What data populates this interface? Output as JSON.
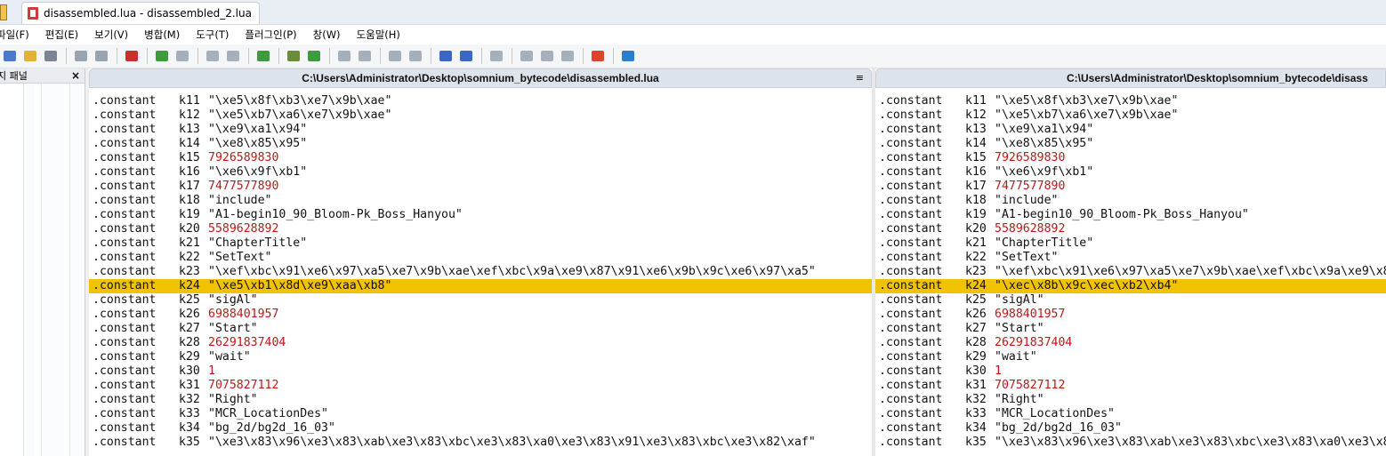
{
  "tab": {
    "title": "disassembled.lua - disassembled_2.lua"
  },
  "menu": [
    "파일(F)",
    "편집(E)",
    "보기(V)",
    "병합(M)",
    "도구(T)",
    "플러그인(P)",
    "창(W)",
    "도움말(H)"
  ],
  "left_panel": {
    "title": "지 패널",
    "close": "×"
  },
  "left_pane": {
    "path": "C:\\Users\\Administrator\\Desktop\\somnium_bytecode\\disassembled.lua",
    "menu_icon": "≡",
    "lines": [
      {
        "dir": ".constant",
        "key": "k11",
        "val": "\"\\xe5\\x8f\\xb3\\xe7\\x9b\\xae\"",
        "num": false
      },
      {
        "dir": ".constant",
        "key": "k12",
        "val": "\"\\xe5\\xb7\\xa6\\xe7\\x9b\\xae\"",
        "num": false
      },
      {
        "dir": ".constant",
        "key": "k13",
        "val": "\"\\xe9\\xa1\\x94\"",
        "num": false
      },
      {
        "dir": ".constant",
        "key": "k14",
        "val": "\"\\xe8\\x85\\x95\"",
        "num": false
      },
      {
        "dir": ".constant",
        "key": "k15",
        "val": "7926589830",
        "num": true
      },
      {
        "dir": ".constant",
        "key": "k16",
        "val": "\"\\xe6\\x9f\\xb1\"",
        "num": false
      },
      {
        "dir": ".constant",
        "key": "k17",
        "val": "7477577890",
        "num": true
      },
      {
        "dir": ".constant",
        "key": "k18",
        "val": "\"include\"",
        "num": false
      },
      {
        "dir": ".constant",
        "key": "k19",
        "val": "\"A1-begin10_90_Bloom-Pk_Boss_Hanyou\"",
        "num": false
      },
      {
        "dir": ".constant",
        "key": "k20",
        "val": "5589628892",
        "num": true
      },
      {
        "dir": ".constant",
        "key": "k21",
        "val": "\"ChapterTitle\"",
        "num": false
      },
      {
        "dir": ".constant",
        "key": "k22",
        "val": "\"SetText\"",
        "num": false
      },
      {
        "dir": ".constant",
        "key": "k23",
        "val": "\"\\xef\\xbc\\x91\\xe6\\x97\\xa5\\xe7\\x9b\\xae\\xef\\xbc\\x9a\\xe9\\x87\\x91\\xe6\\x9b\\x9c\\xe6\\x97\\xa5\"",
        "num": false
      },
      {
        "dir": ".constant",
        "key": "k24",
        "val": "\"\\xe5\\xb1\\x8d\\xe9\\xaa\\xb8\"",
        "num": false,
        "diff": true
      },
      {
        "dir": ".constant",
        "key": "k25",
        "val": "\"sigAl\"",
        "num": false
      },
      {
        "dir": ".constant",
        "key": "k26",
        "val": "6988401957",
        "num": true
      },
      {
        "dir": ".constant",
        "key": "k27",
        "val": "\"Start\"",
        "num": false
      },
      {
        "dir": ".constant",
        "key": "k28",
        "val": "26291837404",
        "num": true
      },
      {
        "dir": ".constant",
        "key": "k29",
        "val": "\"wait\"",
        "num": false
      },
      {
        "dir": ".constant",
        "key": "k30",
        "val": "1",
        "num": true
      },
      {
        "dir": ".constant",
        "key": "k31",
        "val": "7075827112",
        "num": true
      },
      {
        "dir": ".constant",
        "key": "k32",
        "val": "\"Right\"",
        "num": false
      },
      {
        "dir": ".constant",
        "key": "k33",
        "val": "\"MCR_LocationDes\"",
        "num": false
      },
      {
        "dir": ".constant",
        "key": "k34",
        "val": "\"bg_2d/bg2d_16_03\"",
        "num": false
      },
      {
        "dir": ".constant",
        "key": "k35",
        "val": "\"\\xe3\\x83\\x96\\xe3\\x83\\xab\\xe3\\x83\\xbc\\xe3\\x83\\xa0\\xe3\\x83\\x91\\xe3\\x83\\xbc\\xe3\\x82\\xaf\"",
        "num": false
      }
    ]
  },
  "right_pane": {
    "path": "C:\\Users\\Administrator\\Desktop\\somnium_bytecode\\disass",
    "lines": [
      {
        "dir": ".constant",
        "key": "k11",
        "val": "\"\\xe5\\x8f\\xb3\\xe7\\x9b\\xae\"",
        "num": false
      },
      {
        "dir": ".constant",
        "key": "k12",
        "val": "\"\\xe5\\xb7\\xa6\\xe7\\x9b\\xae\"",
        "num": false
      },
      {
        "dir": ".constant",
        "key": "k13",
        "val": "\"\\xe9\\xa1\\x94\"",
        "num": false
      },
      {
        "dir": ".constant",
        "key": "k14",
        "val": "\"\\xe8\\x85\\x95\"",
        "num": false
      },
      {
        "dir": ".constant",
        "key": "k15",
        "val": "7926589830",
        "num": true
      },
      {
        "dir": ".constant",
        "key": "k16",
        "val": "\"\\xe6\\x9f\\xb1\"",
        "num": false
      },
      {
        "dir": ".constant",
        "key": "k17",
        "val": "7477577890",
        "num": true
      },
      {
        "dir": ".constant",
        "key": "k18",
        "val": "\"include\"",
        "num": false
      },
      {
        "dir": ".constant",
        "key": "k19",
        "val": "\"A1-begin10_90_Bloom-Pk_Boss_Hanyou\"",
        "num": false
      },
      {
        "dir": ".constant",
        "key": "k20",
        "val": "5589628892",
        "num": true
      },
      {
        "dir": ".constant",
        "key": "k21",
        "val": "\"ChapterTitle\"",
        "num": false
      },
      {
        "dir": ".constant",
        "key": "k22",
        "val": "\"SetText\"",
        "num": false
      },
      {
        "dir": ".constant",
        "key": "k23",
        "val": "\"\\xef\\xbc\\x91\\xe6\\x97\\xa5\\xe7\\x9b\\xae\\xef\\xbc\\x9a\\xe9\\x8",
        "num": false
      },
      {
        "dir": ".constant",
        "key": "k24",
        "val": "\"\\xec\\x8b\\x9c\\xec\\xb2\\xb4\"",
        "num": false,
        "diff": true
      },
      {
        "dir": ".constant",
        "key": "k25",
        "val": "\"sigAl\"",
        "num": false
      },
      {
        "dir": ".constant",
        "key": "k26",
        "val": "6988401957",
        "num": true
      },
      {
        "dir": ".constant",
        "key": "k27",
        "val": "\"Start\"",
        "num": false
      },
      {
        "dir": ".constant",
        "key": "k28",
        "val": "26291837404",
        "num": true
      },
      {
        "dir": ".constant",
        "key": "k29",
        "val": "\"wait\"",
        "num": false
      },
      {
        "dir": ".constant",
        "key": "k30",
        "val": "1",
        "num": true
      },
      {
        "dir": ".constant",
        "key": "k31",
        "val": "7075827112",
        "num": true
      },
      {
        "dir": ".constant",
        "key": "k32",
        "val": "\"Right\"",
        "num": false
      },
      {
        "dir": ".constant",
        "key": "k33",
        "val": "\"MCR_LocationDes\"",
        "num": false
      },
      {
        "dir": ".constant",
        "key": "k34",
        "val": "\"bg_2d/bg2d_16_03\"",
        "num": false
      },
      {
        "dir": ".constant",
        "key": "k35",
        "val": "\"\\xe3\\x83\\x96\\xe3\\x83\\xab\\xe3\\x83\\xbc\\xe3\\x83\\xa0\\xe3\\x8",
        "num": false
      }
    ]
  },
  "colors": {
    "diff_highlight": "#f0c200",
    "number": "#c41414"
  },
  "toolbar_icons": [
    "new-file-icon",
    "open-folder-icon",
    "save-icon",
    "undo-icon",
    "redo-icon",
    "options-icon",
    "next-diff-icon",
    "prev-diff-icon",
    "first-diff-icon",
    "last-diff-icon",
    "current-diff-icon",
    "next-conflict-icon",
    "prev-conflict-icon",
    "copy-right-icon",
    "copy-left-icon",
    "copy-to-right-icon",
    "copy-to-left-icon",
    "merge-icon",
    "all-left-icon",
    "all-right-icon",
    "left-left-icon",
    "right-right-icon",
    "auto-merge-icon",
    "color-scheme-icon",
    "refresh-icon"
  ]
}
